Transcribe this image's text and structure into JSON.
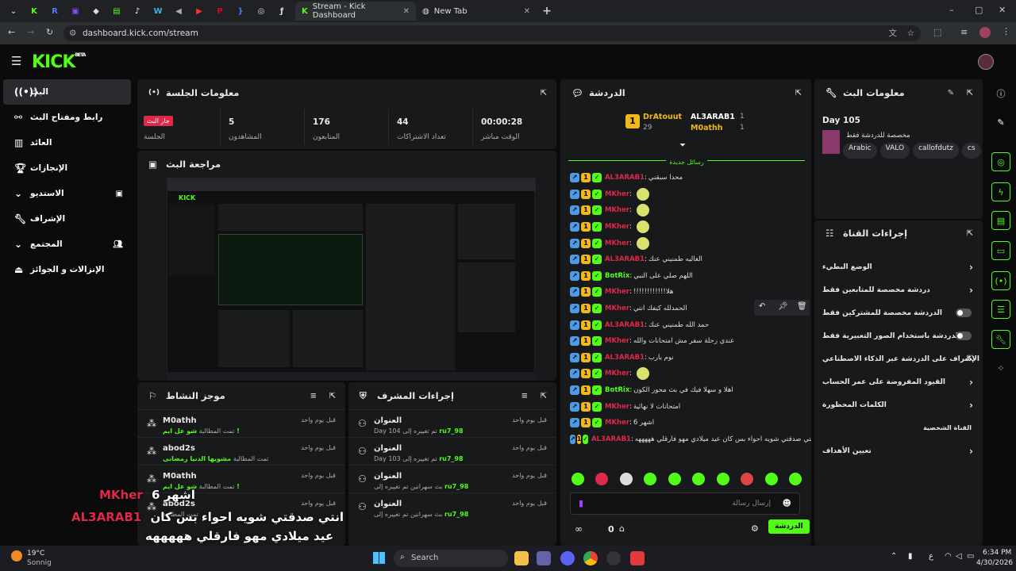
{
  "browser": {
    "tabs": [
      "Stream - Kick Dashboard",
      "New Tab"
    ],
    "url": "dashboard.kick.com/stream"
  },
  "sidebar": {
    "items": [
      {
        "label": "البث",
        "icon": "live-icon"
      },
      {
        "label": "رابط ومفتاح البث",
        "icon": "link-icon"
      },
      {
        "label": "العائد",
        "icon": "chart-icon"
      },
      {
        "label": "الإنجازات",
        "icon": "trophy-icon"
      },
      {
        "label": "الاستديو",
        "icon": "video-icon"
      },
      {
        "label": "الإشراف",
        "icon": "wrench-icon"
      },
      {
        "label": "المجتمع",
        "icon": "users-icon"
      },
      {
        "label": "الإنزالات و الجوائز",
        "icon": "drop-icon"
      }
    ]
  },
  "session": {
    "title": "معلومات الجلسة",
    "live_badge": "جار البث",
    "session_label": "الجلسة",
    "stats": [
      {
        "value": "5",
        "label": "المشاهدون"
      },
      {
        "value": "176",
        "label": "المتابعون"
      },
      {
        "value": "44",
        "label": "تعداد الاشتراكات"
      },
      {
        "value": "00:00:28",
        "label": "الوقت مباشر"
      }
    ]
  },
  "preview": {
    "title": "مراجعة البث"
  },
  "activity": {
    "title": "موجز النشاط",
    "rows": [
      {
        "name": "M0athh",
        "sub": "تمت المطالبة",
        "reward": "شو عل ايم !",
        "time": "قبل يوم واحد"
      },
      {
        "name": "abod2s",
        "sub": "تمت المطالبة",
        "reward": "مشويها الدنيا رمضانى",
        "time": "قبل يوم واحد"
      },
      {
        "name": "M0athh",
        "sub": "تمت المطالبة",
        "reward": "شو عل ايم !",
        "time": "قبل يوم واحد"
      },
      {
        "name": "abod2s",
        "sub": "تمت المطالبة",
        "reward": "",
        "time": "قبل يوم واحد"
      }
    ]
  },
  "modactions": {
    "title": "إجراءات المشرف",
    "rows": [
      {
        "title": "العنوان",
        "detail": "Day 104 تم تغييره إلى",
        "user": "ru7_98",
        "time": "قبل يوم واحد"
      },
      {
        "title": "العنوان",
        "detail": "Day 103 تم تغييره إلى",
        "user": "ru7_98",
        "time": "قبل يوم واحد"
      },
      {
        "title": "العنوان",
        "detail": "بث سهرانين تم تغييره إلى",
        "user": "ru7_98",
        "time": "قبل يوم واحد"
      },
      {
        "title": "العنوان",
        "detail": "بث سهرانين تم تغييره إلى",
        "user": "ru7_98",
        "time": "قبل يوم واحد"
      }
    ]
  },
  "chat": {
    "title": "الدردشة",
    "top": [
      {
        "name": "DrAtouut",
        "count": "29"
      },
      {
        "name": "AL3ARAB1",
        "count": "1"
      },
      {
        "name": "M0athh",
        "count": "1"
      }
    ],
    "new_messages": "رسائل جديدة",
    "messages": [
      {
        "user": "AL3ARAB1",
        "color": "#e0284a",
        "text": "محدا سبقني"
      },
      {
        "user": "MKher",
        "color": "#e0284a",
        "text": ""
      },
      {
        "user": "MKher",
        "color": "#e0284a",
        "text": ""
      },
      {
        "user": "MKher",
        "color": "#e0284a",
        "text": ""
      },
      {
        "user": "MKher",
        "color": "#e0284a",
        "text": ""
      },
      {
        "user": "AL3ARAB1",
        "color": "#e0284a",
        "text": "الغاليه طمنيني عنك"
      },
      {
        "user": "BotRix",
        "color": "#53fc18",
        "text": "اللهم صلي على النبي"
      },
      {
        "user": "MKher",
        "color": "#e0284a",
        "text": "!!!!!!!!!!!!هلا"
      },
      {
        "user": "MKher",
        "color": "#e0284a",
        "text": "الحمدلله كيفك انتي"
      },
      {
        "user": "AL3ARAB1",
        "color": "#e0284a",
        "text": "حمد الله طمنيني عنك"
      },
      {
        "user": "MKher",
        "color": "#e0284a",
        "text": "عندي رحلة سفر مش امتحانات والله"
      },
      {
        "user": "AL3ARAB1",
        "color": "#e0284a",
        "text": "نوم يارب"
      },
      {
        "user": "MKher",
        "color": "#e0284a",
        "text": ""
      },
      {
        "user": "BotRix",
        "color": "#53fc18",
        "text": "اهلا و سهلا فيك في بث محور الكون"
      },
      {
        "user": "MKher",
        "color": "#e0284a",
        "text": "امتحانات لا نهائية"
      },
      {
        "user": "MKher",
        "color": "#e0284a",
        "text": "اشهر 6"
      },
      {
        "user": "AL3ARAB1",
        "color": "#e0284a",
        "text": "انتي صدقتي شويه احواء بس كان عيد ميلادي مهو فارقلي هههههه"
      }
    ],
    "input_placeholder": "إرسال رسالة",
    "points": "0",
    "send_label": "الدردشة"
  },
  "streaminfo": {
    "title": "معلومات البث",
    "stream_title": "Day 105",
    "category": "مخصصة للدردشة فقط",
    "tags": [
      "Arabic",
      "VALO",
      "callofdutz",
      "cs"
    ]
  },
  "channelactions": {
    "title": "إجراءات القناة",
    "items": [
      {
        "label": "الوضع البطيء",
        "ctrl": "chevron"
      },
      {
        "label": "دردشة مخصصة للمتابعين فقط",
        "ctrl": "chevron"
      },
      {
        "label": "الدردشة مخصصة للمشتركين فقط",
        "ctrl": "toggle"
      },
      {
        "label": "الدردشة باستخدام الصور التعبيرية فقط",
        "ctrl": "toggle"
      },
      {
        "label": "الإشراف على الدردشة عبر الذكاء الاصطناعي",
        "ctrl": "external"
      },
      {
        "label": "القيود المفروضة على عمر الحساب",
        "ctrl": "chevron"
      },
      {
        "label": "الكلمات المحظورة",
        "ctrl": "chevron"
      },
      {
        "label": "القناة الشخصية",
        "ctrl": "none"
      },
      {
        "label": "تعيين الأهداف",
        "ctrl": "chevron"
      }
    ]
  },
  "overlay": {
    "line1_user": "MKher",
    "line1_text": "اشهر 6",
    "line2_user": "AL3ARAB1",
    "line2_text": "انتي صدقتي شويه احواء بس كان",
    "line3_text": "عيد ميلادي مهو فارقلي هههههه"
  },
  "taskbar": {
    "weather_temp": "19°C",
    "weather_desc": "Sonnig",
    "search": "Search",
    "time": "6:34 PM",
    "date": "4/30/2026",
    "lang": "ع"
  },
  "colors": {
    "brand": "#53fc18",
    "panel": "#18191b",
    "user_red": "#e0284a"
  }
}
